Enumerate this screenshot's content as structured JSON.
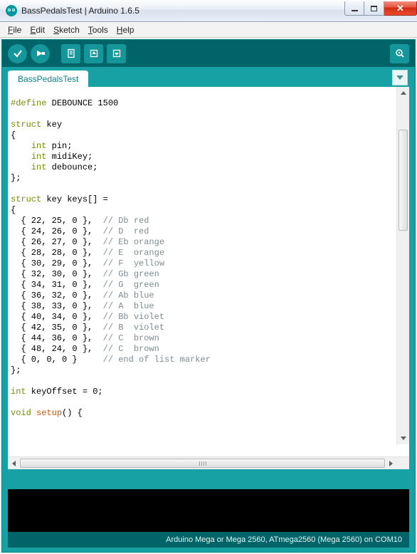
{
  "window": {
    "title": "BassPedalsTest | Arduino 1.6.5"
  },
  "menu": {
    "file": {
      "key": "F",
      "rest": "ile"
    },
    "edit": {
      "key": "E",
      "rest": "dit"
    },
    "sketch": {
      "key": "S",
      "rest": "ketch"
    },
    "tools": {
      "key": "T",
      "rest": "ools"
    },
    "help": {
      "key": "H",
      "rest": "elp"
    }
  },
  "tabs": {
    "active": "BassPedalsTest"
  },
  "code": {
    "define_kw": "#define",
    "define_rest": " DEBOUNCE 1500",
    "struct_kw": "struct",
    "int_kw": "int",
    "void_kw": "void",
    "setup_kw": "setup",
    "struct_key_decl": " key",
    "open_brace": "{",
    "close_brace": "};",
    "close_brace_plain": "}",
    "field_pin": " pin;",
    "field_midi": " midiKey;",
    "field_deb": " debounce;",
    "keys_decl": " key keys[] =",
    "rows": [
      {
        "vals": "  { 22, 25, 0 },  ",
        "comment": "// Db red"
      },
      {
        "vals": "  { 24, 26, 0 },  ",
        "comment": "// D  red"
      },
      {
        "vals": "  { 26, 27, 0 },  ",
        "comment": "// Eb orange"
      },
      {
        "vals": "  { 28, 28, 0 },  ",
        "comment": "// E  orange"
      },
      {
        "vals": "  { 30, 29, 0 },  ",
        "comment": "// F  yellow"
      },
      {
        "vals": "  { 32, 30, 0 },  ",
        "comment": "// Gb green"
      },
      {
        "vals": "  { 34, 31, 0 },  ",
        "comment": "// G  green"
      },
      {
        "vals": "  { 36, 32, 0 },  ",
        "comment": "// Ab blue"
      },
      {
        "vals": "  { 38, 33, 0 },  ",
        "comment": "// A  blue"
      },
      {
        "vals": "  { 40, 34, 0 },  ",
        "comment": "// Bb violet"
      },
      {
        "vals": "  { 42, 35, 0 },  ",
        "comment": "// B  violet"
      },
      {
        "vals": "  { 44, 36, 0 },  ",
        "comment": "// C  brown"
      },
      {
        "vals": "  { 48, 24, 0 },  ",
        "comment": "// C  brown"
      }
    ],
    "endmarker_vals": "  { 0, 0, 0 }     ",
    "endmarker_comment": "// end of list marker",
    "keyoffset_decl": " keyOffset = 0;",
    "setup_sig": "() {"
  },
  "footer": {
    "board": "Arduino Mega or Mega 2560, ATmega2560 (Mega 2560) on COM10"
  }
}
